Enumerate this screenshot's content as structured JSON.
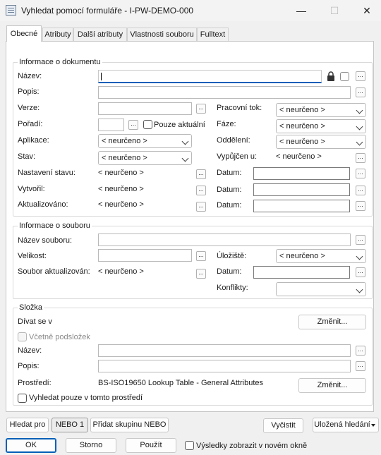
{
  "window": {
    "title": "Vyhledat pomocí formuláře - I-PW-DEMO-000",
    "minimize": "—",
    "maximize": "☐",
    "close": "✕"
  },
  "tabs": [
    "Obecné",
    "Atributy",
    "Další atributy",
    "Vlastnosti souboru",
    "Fulltext"
  ],
  "document_info": {
    "legend": "Informace o dokumentu",
    "name_label": "Název:",
    "description_label": "Popis:",
    "version_label": "Verze:",
    "order_label": "Pořadí:",
    "current_only_label": "Pouze aktuální",
    "application_label": "Aplikace:",
    "application_value": "< neurčeno >",
    "state_label": "Stav:",
    "state_value": "< neurčeno >",
    "state_setting_label": "Nastavení stavu:",
    "state_setting_value": "< neurčeno >",
    "created_by_label": "Vytvořil:",
    "created_by_value": "< neurčeno >",
    "updated_by_label": "Aktualizováno:",
    "updated_by_value": "< neurčeno >",
    "workflow_label": "Pracovní tok:",
    "workflow_value": "< neurčeno >",
    "phase_label": "Fáze:",
    "phase_value": "< neurčeno >",
    "department_label": "Oddělení:",
    "department_value": "< neurčeno >",
    "checked_out_label": "Vypůjčen u:",
    "checked_out_value": "< neurčeno >",
    "date_label": "Datum:"
  },
  "file_info": {
    "legend": "Informace o souboru",
    "file_name_label": "Název souboru:",
    "size_label": "Velikost:",
    "file_updated_label": "Soubor aktualizován:",
    "file_updated_value": "< neurčeno >",
    "storage_label": "Úložiště:",
    "storage_value": "< neurčeno >",
    "date_label": "Datum:",
    "conflicts_label": "Konflikty:"
  },
  "folder": {
    "legend": "Složka",
    "look_in_label": "Dívat se v",
    "change_button": "Změnit...",
    "include_subfolders_label": "Včetně podsložek",
    "name_label": "Název:",
    "description_label": "Popis:",
    "environment_label": "Prostředí:",
    "environment_value": "BS-ISO19650 Lookup Table - General Attributes",
    "change_env_button": "Změnit...",
    "search_in_env_label": "Vyhledat pouze v tomto prostředí"
  },
  "bottom": {
    "search_for_button": "Hledat pro",
    "or1_button": "NEBO 1",
    "add_or_group_button": "Přidat skupinu NEBO",
    "clear_button": "Vyčistit",
    "saved_searches_button": "Uložená hledání",
    "ok_button": "OK",
    "cancel_button": "Storno",
    "apply_button": "Použít",
    "new_window_label": "Výsledky zobrazit v novém okně"
  },
  "dots": "..."
}
